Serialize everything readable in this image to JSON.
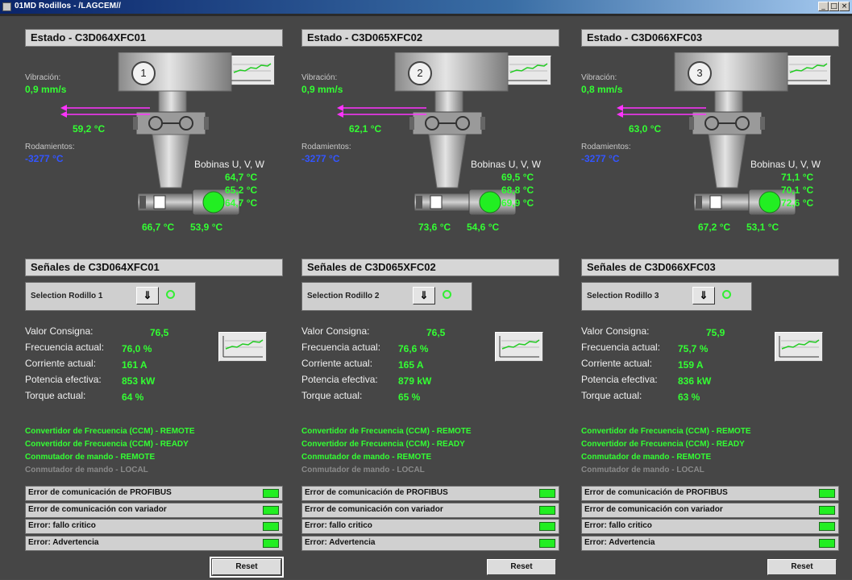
{
  "window": {
    "title": "01MD Rodillos - /LAGCEM//",
    "min": "_",
    "max": "□",
    "close": "×"
  },
  "colors": {
    "green": "#33ff33",
    "blue": "#3355ff",
    "led_on": "#22ee22"
  },
  "columns": [
    {
      "estado_title": "Estado - C3D064XFC01",
      "roller_number": "1",
      "vibracion_label": "Vibración:",
      "vibracion_value": "0,9 mm/s",
      "rod_temp_top": "59,2 °C",
      "rodamientos_label": "Rodamientos:",
      "rodamientos_value": "-3277 °C",
      "bobinas_label": "Bobinas U, V, W",
      "bobinas": [
        "64,7 °C",
        "65,2 °C",
        "64,7 °C"
      ],
      "bearing_left": "66,7 °C",
      "bearing_right": "53,9 °C",
      "senales_title": "Señales de C3D064XFC01",
      "selection_label": "Selection Rodillo 1",
      "selection_button": "⇓",
      "signals": [
        {
          "label": "Valor Consigna:",
          "value": "76,5"
        },
        {
          "label": "Frecuencia actual:",
          "value": "76,0 %"
        },
        {
          "label": "Corriente actual:",
          "value": "161 A"
        },
        {
          "label": "Potencia efectiva:",
          "value": "853 kW"
        },
        {
          "label": "Torque actual:",
          "value": "64 %"
        }
      ],
      "status": [
        {
          "text": "Convertidor de Frecuencia (CCM) - REMOTE",
          "color": "#33ff33"
        },
        {
          "text": "Convertidor de Frecuencia (CCM) - READY",
          "color": "#33ff33"
        },
        {
          "text": "Conmutador de mando - REMOTE",
          "color": "#33ff33"
        },
        {
          "text": "Conmutador de mando - LOCAL",
          "color": "#8a8a8a"
        }
      ],
      "errors": [
        "Error de comunicación de PROFIBUS",
        "Error de comunicación con variador",
        "Error: fallo critico",
        "Error: Advertencia"
      ],
      "reset_label": "Reset"
    },
    {
      "estado_title": "Estado - C3D065XFC02",
      "roller_number": "2",
      "vibracion_label": "Vibración:",
      "vibracion_value": "0,9 mm/s",
      "rod_temp_top": "62,1 °C",
      "rodamientos_label": "Rodamientos:",
      "rodamientos_value": "-3277 °C",
      "bobinas_label": "Bobinas U, V, W",
      "bobinas": [
        "69,5 °C",
        "68,8 °C",
        "69,9 °C"
      ],
      "bearing_left": "73,6 °C",
      "bearing_right": "54,6 °C",
      "senales_title": "Señales de C3D065XFC02",
      "selection_label": "Selection Rodillo 2",
      "selection_button": "⇓",
      "signals": [
        {
          "label": "Valor Consigna:",
          "value": "76,5"
        },
        {
          "label": "Frecuencia actual:",
          "value": "76,6 %"
        },
        {
          "label": "Corriente actual:",
          "value": "165 A"
        },
        {
          "label": "Potencia efectiva:",
          "value": "879 kW"
        },
        {
          "label": "Torque actual:",
          "value": "65 %"
        }
      ],
      "status": [
        {
          "text": "Convertidor de Frecuencia (CCM) - REMOTE",
          "color": "#33ff33"
        },
        {
          "text": "Convertidor de Frecuencia (CCM) - READY",
          "color": "#33ff33"
        },
        {
          "text": "Conmutador de mando - REMOTE",
          "color": "#33ff33"
        },
        {
          "text": "Conmutador de mando - LOCAL",
          "color": "#8a8a8a"
        }
      ],
      "errors": [
        "Error de comunicación de PROFIBUS",
        "Error de comunicación con variador",
        "Error: fallo critico",
        "Error: Advertencia"
      ],
      "reset_label": "Reset"
    },
    {
      "estado_title": "Estado - C3D066XFC03",
      "roller_number": "3",
      "vibracion_label": "Vibración:",
      "vibracion_value": "0,8 mm/s",
      "rod_temp_top": "63,0 °C",
      "rodamientos_label": "Rodamientos:",
      "rodamientos_value": "-3277 °C",
      "bobinas_label": "Bobinas U, V, W",
      "bobinas": [
        "71,1 °C",
        "70,1 °C",
        "72,6 °C"
      ],
      "bearing_left": "67,2 °C",
      "bearing_right": "53,1 °C",
      "senales_title": "Señales de C3D066XFC03",
      "selection_label": "Selection Rodillo 3",
      "selection_button": "⇓",
      "signals": [
        {
          "label": "Valor Consigna:",
          "value": "75,9"
        },
        {
          "label": "Frecuencia actual:",
          "value": "75,7 %"
        },
        {
          "label": "Corriente actual:",
          "value": "159 A"
        },
        {
          "label": "Potencia efectiva:",
          "value": "836 kW"
        },
        {
          "label": "Torque actual:",
          "value": "63 %"
        }
      ],
      "status": [
        {
          "text": "Convertidor de Frecuencia (CCM) - REMOTE",
          "color": "#33ff33"
        },
        {
          "text": "Convertidor de Frecuencia (CCM) - READY",
          "color": "#33ff33"
        },
        {
          "text": "Conmutador de mando - REMOTE",
          "color": "#33ff33"
        },
        {
          "text": "Conmutador de mando - LOCAL",
          "color": "#8a8a8a"
        }
      ],
      "errors": [
        "Error de comunicación de PROFIBUS",
        "Error de comunicación con variador",
        "Error: fallo critico",
        "Error: Advertencia"
      ],
      "reset_label": "Reset"
    }
  ]
}
